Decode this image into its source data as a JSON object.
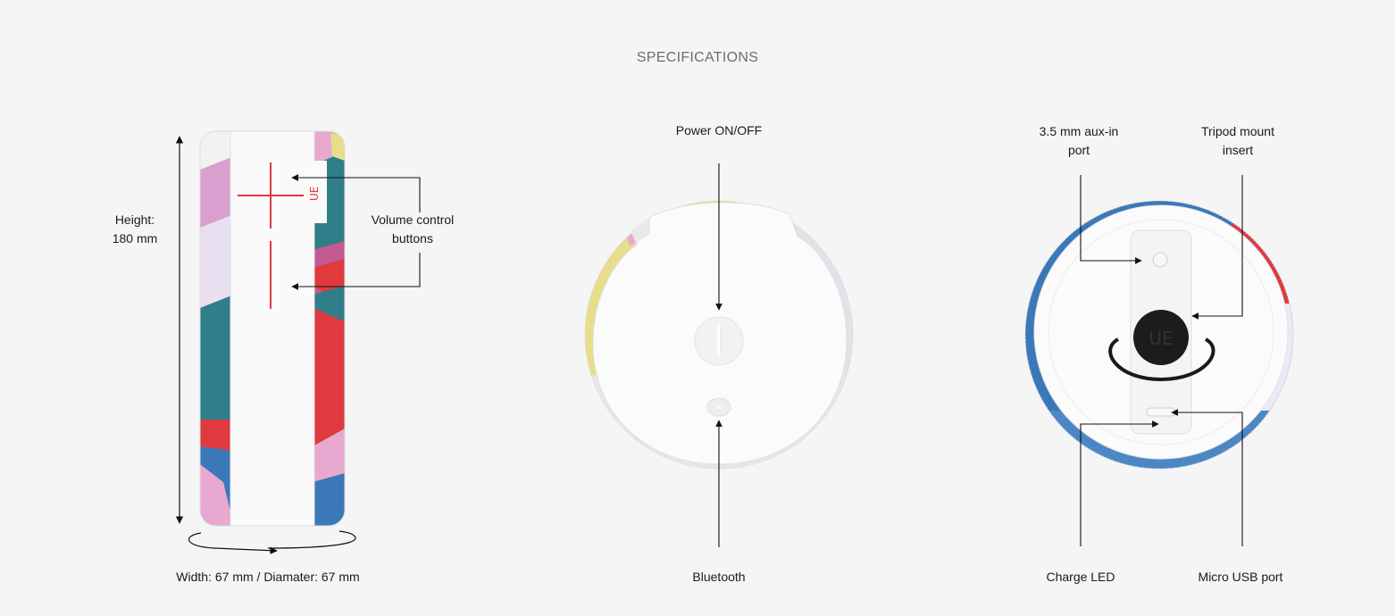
{
  "page": {
    "title": "SPECIFICATIONS"
  },
  "side_view": {
    "height_label_line1": "Height:",
    "height_label_line2": "180 mm",
    "volume_label_line1": "Volume control",
    "volume_label_line2": "buttons",
    "width_label": "Width: 67 mm / Diamater: 67 mm"
  },
  "top_view": {
    "power_label": "Power ON/OFF",
    "bluetooth_label": "Bluetooth"
  },
  "bottom_view": {
    "aux_label_line1": "3.5 mm aux-in",
    "aux_label_line2": "port",
    "tripod_label_line1": "Tripod mount",
    "tripod_label_line2": "insert",
    "charge_led_label": "Charge LED",
    "micro_usb_label": "Micro USB port"
  },
  "colors": {
    "background": "#f5f5f5",
    "accent_red": "#e03a3e",
    "fabric_blue": "#3b78b8",
    "fabric_teal": "#2f7e8a",
    "fabric_pink": "#e7a9d0",
    "fabric_yellow": "#e8dd8a",
    "body_white": "#fafafa",
    "line_dark": "#111111"
  }
}
